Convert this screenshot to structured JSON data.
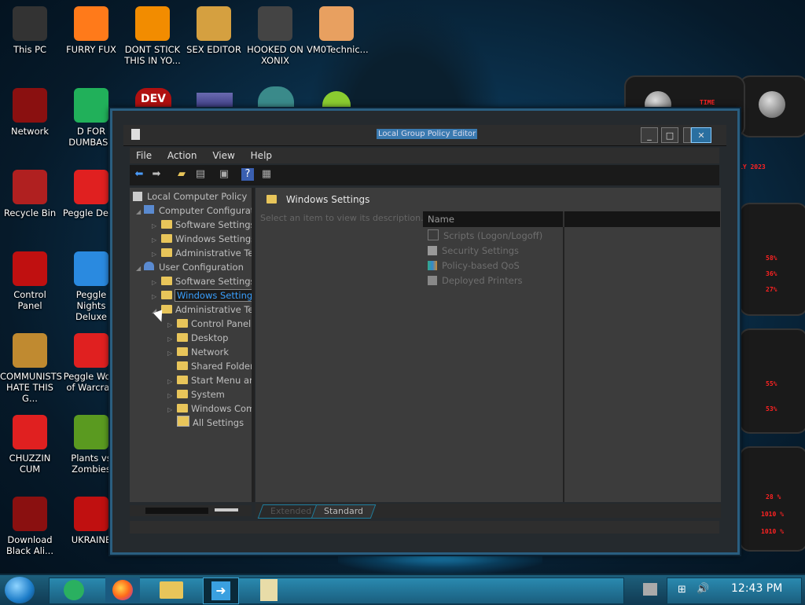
{
  "desktop_icons": [
    {
      "label": "This PC",
      "icon": "this-pc-icon",
      "color": "#333"
    },
    {
      "label": "FURRY FUX",
      "icon": "firefox-icon",
      "color": "#ff7a1a"
    },
    {
      "label": "DONT STICK THIS IN YO...",
      "icon": "vlc-icon",
      "color": "#f28c00"
    },
    {
      "label": "SEX EDITOR",
      "icon": "hxd-icon",
      "color": "#d5a040"
    },
    {
      "label": "HOOKED ON XONIX",
      "icon": "xonix-icon",
      "color": "#444"
    },
    {
      "label": "VM0Technic...",
      "icon": "person-icon",
      "color": "#e8a060"
    },
    {
      "label": "Network",
      "icon": "network-icon",
      "color": "#8a1010"
    },
    {
      "label": "D FOR DUMBASS",
      "icon": "chat-icon",
      "color": "#21b05a"
    },
    {
      "label": "Recycle Bin",
      "icon": "recycle-bin-icon",
      "color": "#b02020"
    },
    {
      "label": "Peggle Del...",
      "icon": "peggle-icon",
      "color": "#e02020"
    },
    {
      "label": "Control Panel",
      "icon": "control-panel-icon",
      "color": "#c01010"
    },
    {
      "label": "Peggle Nights Deluxe",
      "icon": "peggle-nights-icon",
      "color": "#2a8ae0"
    },
    {
      "label": "COMMUNISTS HATE THIS G...",
      "icon": "money-bag-icon",
      "color": "#c08a30"
    },
    {
      "label": "Peggle Wo... of Warcraft",
      "icon": "peggle-wow-icon",
      "color": "#e02020"
    },
    {
      "label": "CHUZZIN CUM",
      "icon": "chuzzle-icon",
      "color": "#e02020"
    },
    {
      "label": "Plants vs Zombies",
      "icon": "pvz-icon",
      "color": "#5a9a20"
    },
    {
      "label": "Download Black Ali...",
      "icon": "alien-icon",
      "color": "#8a1010"
    },
    {
      "label": "UKRAINE",
      "icon": "radiation-icon",
      "color": "#c01010"
    }
  ],
  "desktop_partial": {
    "dev_label": "DEV"
  },
  "widget": {
    "labels": [
      "TIME",
      "LY 2023",
      "58%",
      "36%",
      "27%",
      "55%",
      "53%",
      "28 %",
      "1010 %",
      "1010 %"
    ]
  },
  "window": {
    "title": "Local Group Policy Editor",
    "menu": [
      "File",
      "Action",
      "View",
      "Help"
    ],
    "tree": {
      "root": "Local Computer Policy",
      "computer_config": "Computer Configurati",
      "cc_children": [
        "Software Settings",
        "Windows Settings",
        "Administrative Ten"
      ],
      "user_config": "User Configuration",
      "uc_children": [
        "Software Settings",
        "Windows Settings",
        "Administrative Ten"
      ],
      "admin_children": [
        "Control Panel",
        "Desktop",
        "Network",
        "Shared Folder",
        "Start Menu an",
        "System",
        "Windows Com",
        "All Settings"
      ]
    },
    "content": {
      "heading": "Windows Settings",
      "description": "Select an item to view its description.",
      "column_name": "Name",
      "items": [
        "Scripts (Logon/Logoff)",
        "Security Settings",
        "Policy-based QoS",
        "Deployed Printers"
      ]
    },
    "tabs": [
      "Extended",
      "Standard"
    ]
  },
  "taskbar": {
    "time": "12:43 PM"
  }
}
